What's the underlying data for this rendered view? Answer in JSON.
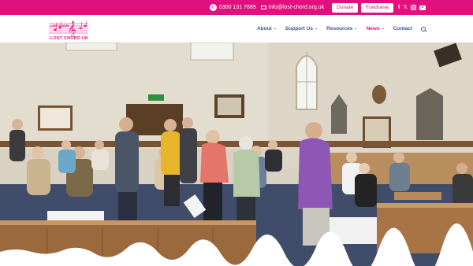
{
  "topbar": {
    "phone_icon": "phone-icon",
    "phone": "0300 131 7889",
    "email_icon": "envelope-icon",
    "email": "info@lost-chord.org.uk",
    "donate_label": "Donate",
    "fundraise_label": "Fundraise",
    "social_icons": [
      "facebook-icon",
      "x-icon",
      "instagram-icon",
      "youtube-icon"
    ],
    "accent_color": "#e0117e"
  },
  "header": {
    "logo_text": "LOST CHORD UK",
    "logo_mark": "LOST CHORD",
    "nav": [
      {
        "label": "About",
        "has_dropdown": true,
        "active": false
      },
      {
        "label": "Support Us",
        "has_dropdown": true,
        "active": false
      },
      {
        "label": "Resources",
        "has_dropdown": true,
        "active": false
      },
      {
        "label": "News",
        "has_dropdown": true,
        "active": true
      },
      {
        "label": "Contact",
        "has_dropdown": false,
        "active": false
      }
    ],
    "nav_color": "#3a4fa0",
    "search_icon": "search-icon"
  },
  "hero": {
    "image": "photo of a music session in a church hall with people seated and standing"
  }
}
